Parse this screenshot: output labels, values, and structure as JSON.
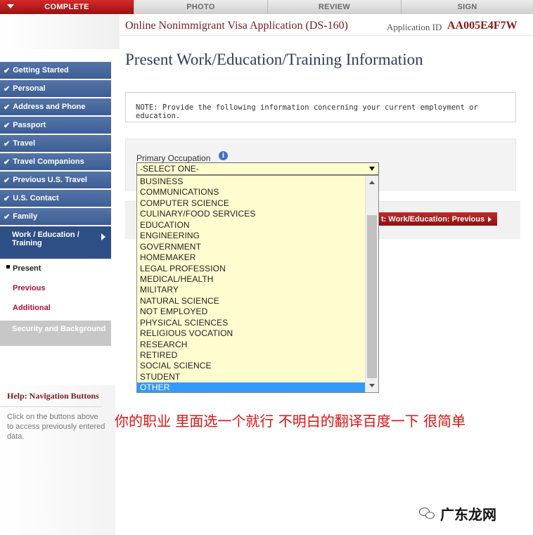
{
  "progress_tabs": [
    {
      "label": "COMPLETE",
      "state": "complete"
    },
    {
      "label": "PHOTO",
      "state": "pending"
    },
    {
      "label": "REVIEW",
      "state": "pending"
    },
    {
      "label": "SIGN",
      "state": "pending"
    }
  ],
  "header": {
    "app_title": "Online Nonimmigrant Visa Application (DS-160)",
    "app_id_label": "Application ID",
    "app_id_value": "AA005E4F7W"
  },
  "sidebar": {
    "items": [
      {
        "label": "Getting Started"
      },
      {
        "label": "Personal"
      },
      {
        "label": "Address and Phone"
      },
      {
        "label": "Passport"
      },
      {
        "label": "Travel"
      },
      {
        "label": "Travel Companions"
      },
      {
        "label": "Previous U.S. Travel"
      },
      {
        "label": "U.S. Contact"
      },
      {
        "label": "Family"
      }
    ],
    "current": {
      "label": "Work / Education / Training"
    },
    "subitems": [
      {
        "label": "Present"
      },
      {
        "label": "Previous"
      },
      {
        "label": "Additional"
      }
    ],
    "disabled": {
      "label": "Security and Background"
    }
  },
  "help": {
    "title": "Help: Navigation Buttons",
    "text": "Click on the buttons above to access previously entered data."
  },
  "main": {
    "page_title": "Present Work/Education/Training Information",
    "note": "NOTE: Provide the following information concerning your current employment or education.",
    "field_label": "Primary Occupation",
    "info_icon_glyph": "i",
    "select_value": "-SELECT ONE-",
    "options": [
      "BUSINESS",
      "COMMUNICATIONS",
      "COMPUTER SCIENCE",
      "CULINARY/FOOD SERVICES",
      "EDUCATION",
      "ENGINEERING",
      "GOVERNMENT",
      "HOMEMAKER",
      "LEGAL PROFESSION",
      "MEDICAL/HEALTH",
      "MILITARY",
      "NATURAL SCIENCE",
      "NOT EMPLOYED",
      "PHYSICAL SCIENCES",
      "RELIGIOUS VOCATION",
      "RESEARCH",
      "RETIRED",
      "SOCIAL SCIENCE",
      "STUDENT",
      "OTHER"
    ],
    "highlighted_option": "OTHER",
    "previous_button": "t: Work/Education: Previous"
  },
  "annotation": "你的职业  里面选一个就行  不明白的翻译百度一下  很简单",
  "watermark": "广东龙网",
  "colors": {
    "complete_red": "#b01a1a",
    "sidebar_blue": "#4a6aa0",
    "title_navy": "#2c3e63",
    "link_crimson": "#b0103a",
    "select_bg": "#fffdd0",
    "highlight_blue": "#3399ff",
    "annotation_red": "#e11212"
  }
}
